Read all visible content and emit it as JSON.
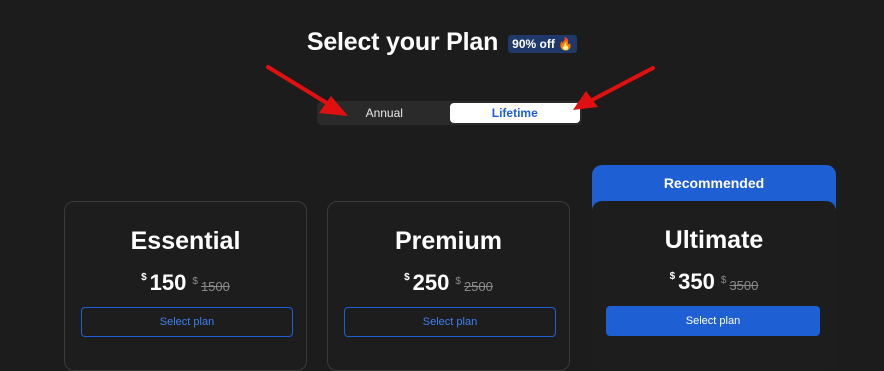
{
  "header": {
    "title": "Select your Plan",
    "badge_text": "90% off",
    "badge_icon": "fire-icon"
  },
  "billing_toggle": {
    "options": [
      "Annual",
      "Lifetime"
    ],
    "selected": "Lifetime"
  },
  "plans": [
    {
      "name": "Essential",
      "currency": "$",
      "price": "150",
      "old_currency": "$",
      "old_price": "1500",
      "button": "Select plan"
    },
    {
      "name": "Premium",
      "currency": "$",
      "price": "250",
      "old_currency": "$",
      "old_price": "2500",
      "button": "Select plan"
    },
    {
      "name": "Ultimate",
      "currency": "$",
      "price": "350",
      "old_currency": "$",
      "old_price": "3500",
      "button": "Select plan",
      "ribbon": "Recommended"
    }
  ],
  "colors": {
    "background": "#1c1c1c",
    "accent": "#1f5fd4",
    "annotation_arrow": "#e01010"
  }
}
